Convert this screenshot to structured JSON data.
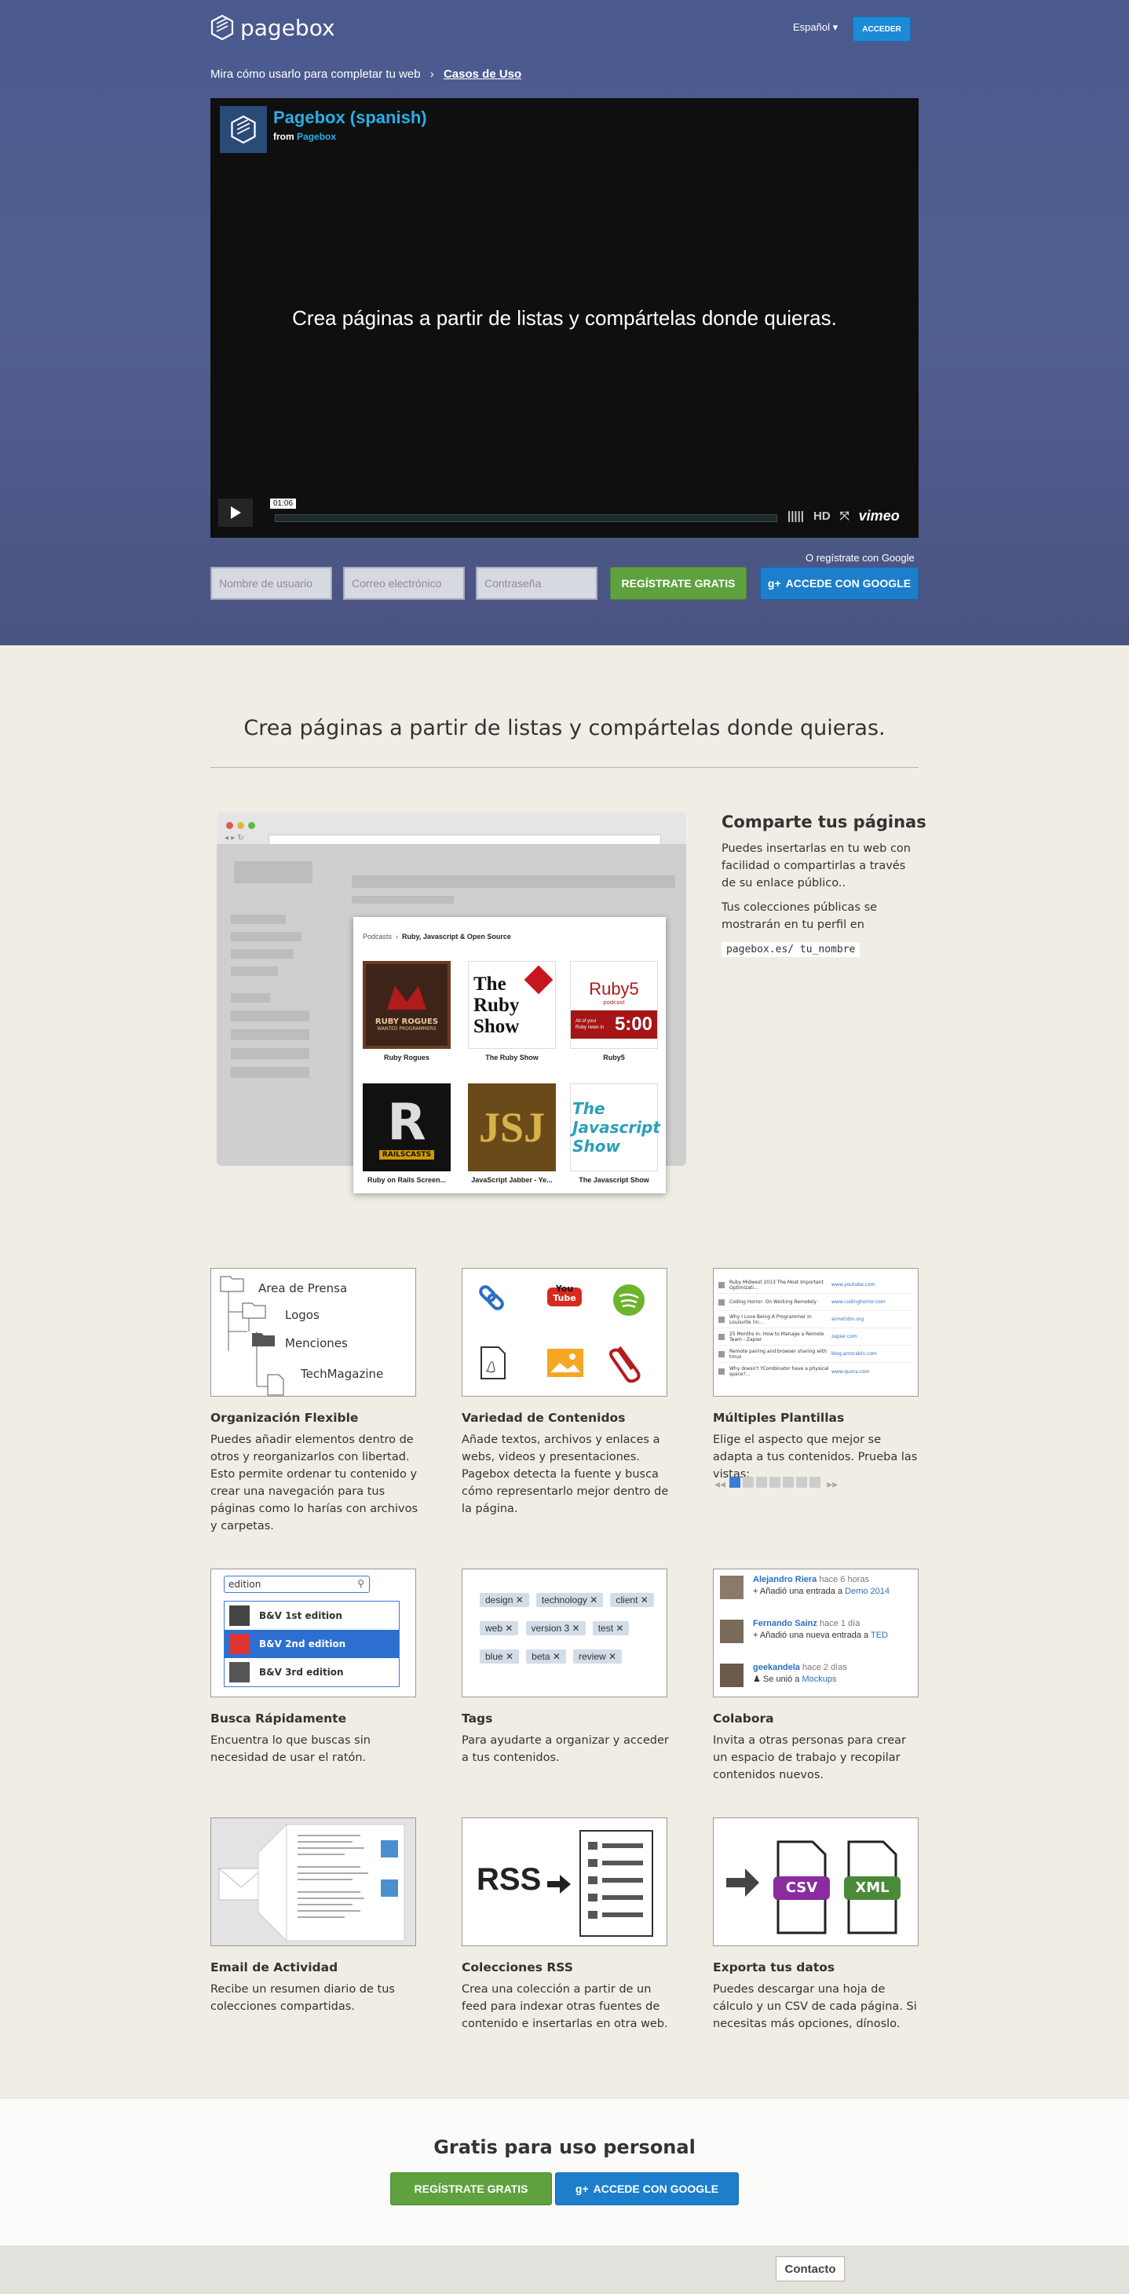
{
  "header": {
    "brand": "pagebox",
    "language": "Español",
    "login": "ACCEDER"
  },
  "breadcrumb": {
    "text": "Mira cómo usarlo para completar tu web",
    "link": "Casos de Uso"
  },
  "video": {
    "title": "Pagebox (spanish)",
    "from_label": "from",
    "from_name": "Pagebox",
    "caption": "Crea páginas a partir de listas y compártelas donde quieras.",
    "time": "01:06",
    "hd": "HD",
    "provider": "vimeo"
  },
  "signup": {
    "google_note": "O regístrate con Google",
    "username_placeholder": "Nombre de usuario",
    "email_placeholder": "Correo electrónico",
    "password_placeholder": "Contraseña",
    "register": "REGÍSTRATE GRATIS",
    "google": "ACCEDE CON GOOGLE",
    "google_glyph": "g+"
  },
  "tagline": "Crea páginas a partir de listas y compártelas donde quieras.",
  "share": {
    "title": "Comparte tus páginas",
    "p1": "Puedes insertarlas en tu web con facilidad o compartirlas a través de su enlace público..",
    "p2": "Tus colecciones públicas se mostrarán en tu perfil en",
    "code": "pagebox.es/ tu_nombre",
    "popup_crumb_root": "Podcasts",
    "popup_crumb_page": "Ruby, Javascript & Open Source",
    "podcasts": [
      "Ruby Rogues",
      "The Ruby Show",
      "Ruby5",
      "Ruby on Rails Screen...",
      "JavaScript Jabber - Ye...",
      "The Javascript Show"
    ],
    "art_text": {
      "ruby_rogues": "RUBY ROGUES",
      "ruby_rogues_sub": "WANTED PROGRAMMERS",
      "ruby_show": "The Ruby Show",
      "ruby5_name": "Ruby5",
      "ruby5_sub": "podcast",
      "ruby5_time": "5:00",
      "ruby5_note": "All of your Ruby news in",
      "railscasts": "RAILSCASTS",
      "js_show": "The Javascript Show"
    }
  },
  "features": [
    {
      "title": "Organización Flexible",
      "text": "Puedes añadir elementos dentro de otros y reorganizarlos con libertad. Esto permite ordenar tu contenido y crear una navegación para tus páginas como lo harías con archivos y carpetas."
    },
    {
      "title": "Variedad de Contenidos",
      "text": "Añade textos, archivos y enlaces a webs, videos y presentaciones. Pagebox detecta la fuente y busca cómo representarlo mejor dentro de la página."
    },
    {
      "title": "Múltiples Plantillas",
      "text": "Elige el aspecto que mejor se adapta a tus contenidos. Prueba las vistas:"
    },
    {
      "title": "Busca Rápidamente",
      "text": "Encuentra lo que buscas sin necesidad de usar el ratón."
    },
    {
      "title": "Tags",
      "text": "Para ayudarte a organizar y acceder a tus contenidos."
    },
    {
      "title": "Colabora",
      "text": "Invita a otras personas para crear un espacio de trabajo y recopilar contenidos nuevos."
    },
    {
      "title": "Email de Actividad",
      "text": "Recibe un resumen diario de tus colecciones compartidas."
    },
    {
      "title": "Colecciones RSS",
      "text": "Crea una colección a partir de un feed para indexar otras fuentes de contenido e insertarlas en otra web."
    },
    {
      "title": "Exporta tus datos",
      "text": "Puedes descargar una hoja de cálculo y un CSV de cada página. Si necesitas más opciones, dínoslo."
    }
  ],
  "folders": [
    "Area de Prensa",
    "Logos",
    "Menciones",
    "TechMagazine"
  ],
  "content_art": {
    "youtube_you": "You",
    "youtube_tube": "Tube"
  },
  "list_rows": [
    {
      "title": "Ruby Midwest 2013 The Most Important Optimizati...",
      "url": "www.youtube.com"
    },
    {
      "title": "Coding Horror: On Working Remotely",
      "url": "www.codinghorror.com"
    },
    {
      "title": "Why I Love Being A Programmer in Louisville (in...",
      "url": "armstrdm.org"
    },
    {
      "title": "25 Months In: How to Manage a Remote Team - Zapier",
      "url": "zapier.com"
    },
    {
      "title": "Remote pairing and browser sharing with tmux",
      "url": "blog.arrocabin.com"
    },
    {
      "title": "Why doesn't YCombinator have a physical space?...",
      "url": "www.quora.com"
    }
  ],
  "search": {
    "query": "edition",
    "results": [
      "B&V 1st edition",
      "B&V 2nd edition",
      "B&V 3rd edition"
    ]
  },
  "tags": [
    "design",
    "technology",
    "client",
    "web",
    "version 3",
    "test",
    "blue",
    "beta",
    "review"
  ],
  "activity": [
    {
      "user": "Alejandro Riera",
      "when": "hace 6 horas",
      "action": "Añadió una entrada a",
      "target": "Demo 2014"
    },
    {
      "user": "Fernando Sainz",
      "when": "hace 1 día",
      "action": "Añadió una nueva entrada a",
      "target": "TED"
    },
    {
      "user": "geekandela",
      "when": "hace 2 días",
      "action": "Se unió a",
      "target": "Mockups"
    }
  ],
  "rss_label": "RSS",
  "export_labels": {
    "csv": "CSV",
    "xml": "XML"
  },
  "cta": {
    "title": "Gratis para uso personal",
    "register": "REGÍSTRATE GRATIS",
    "google": "ACCEDE CON GOOGLE",
    "google_glyph": "g+"
  },
  "footer": {
    "contact": "Contacto"
  }
}
